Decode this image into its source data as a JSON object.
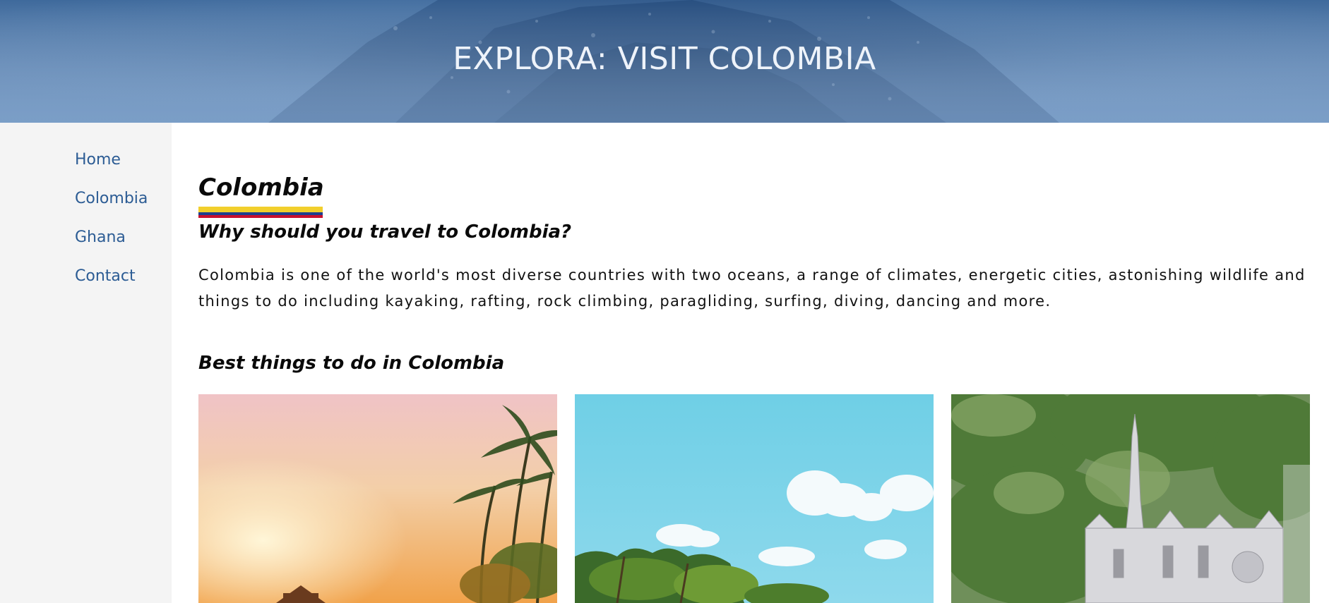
{
  "header": {
    "title": "EXPLORA: VISIT COLOMBIA"
  },
  "sidebar": {
    "items": [
      {
        "label": "Home"
      },
      {
        "label": "Colombia"
      },
      {
        "label": "Ghana"
      },
      {
        "label": "Contact"
      }
    ]
  },
  "main": {
    "title": "Colombia",
    "subtitle": "Why should you travel to Colombia?",
    "intro": "Colombia is one of the world's most diverse countries with two oceans, a range of climates, energetic cities, astonishing wildlife and things to do including kayaking, rafting, rock climbing, paragliding, surfing, diving, dancing and more.",
    "section_title": "Best things to do in Colombia",
    "gallery": [
      {
        "icon": "sunset-palm-beach-photo"
      },
      {
        "icon": "tropical-sky-beach-photo"
      },
      {
        "icon": "las-lajas-sanctuary-photo"
      }
    ]
  },
  "colors": {
    "header_blue": "#4f79ab",
    "link_blue": "#2c5c94",
    "flag_yellow": "#f2cf2c",
    "flag_blue": "#1f3f8f",
    "flag_red": "#c8102e"
  }
}
